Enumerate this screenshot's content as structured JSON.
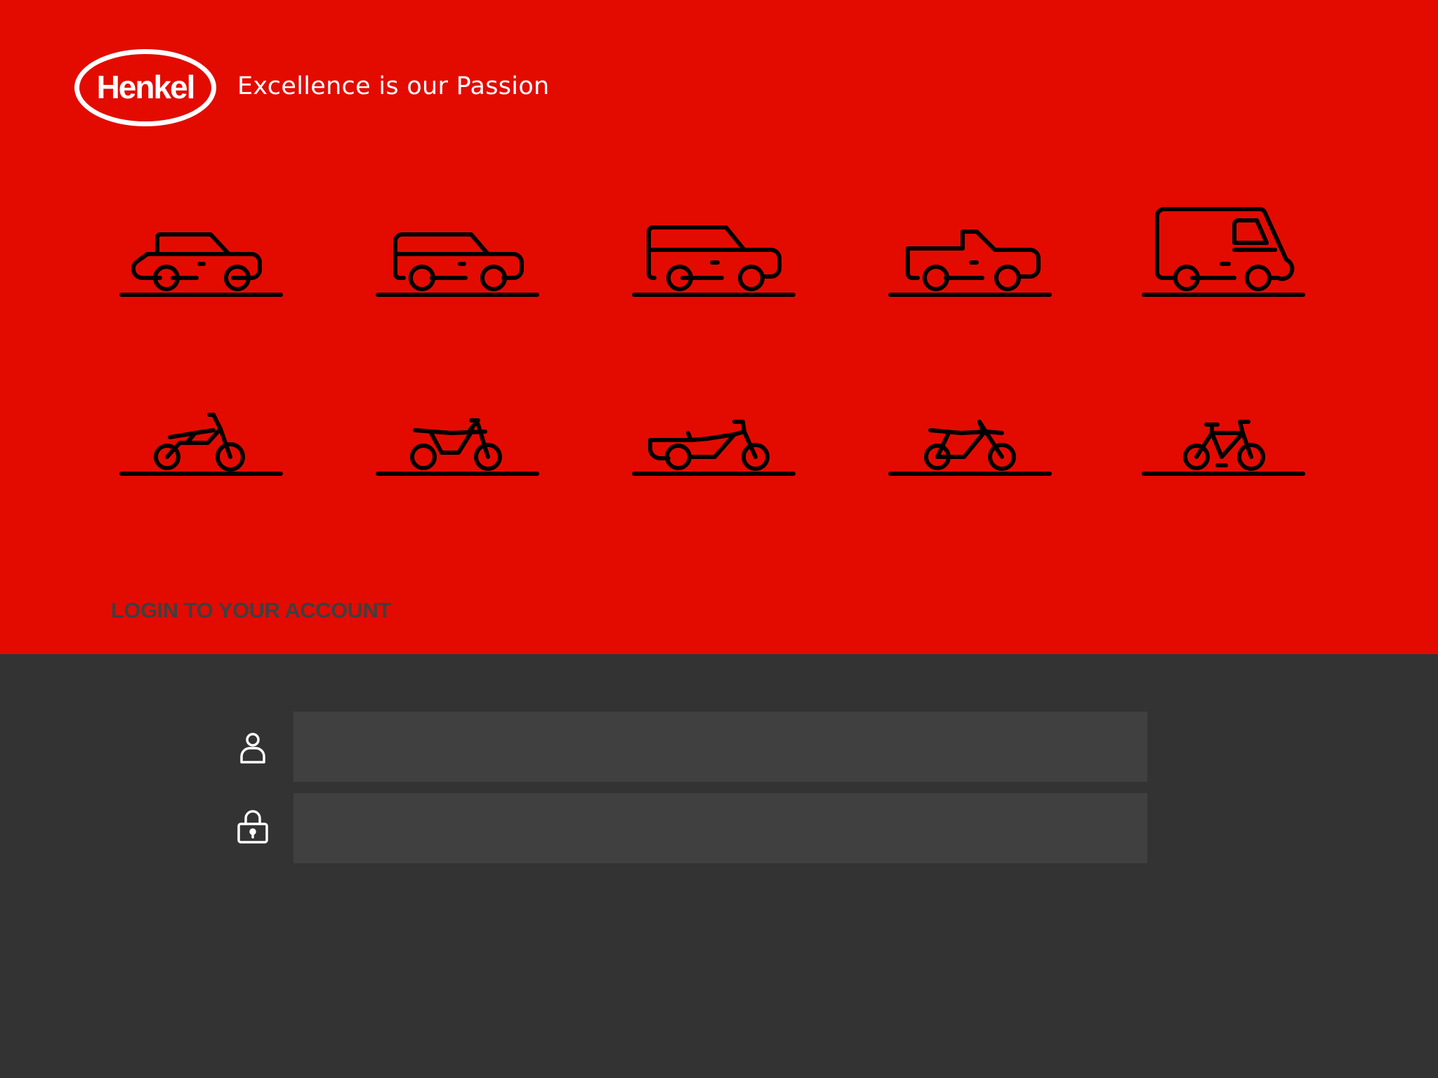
{
  "brand": {
    "logo_text": "Henkel",
    "tagline": "Excellence is our Passion",
    "colors": {
      "primary": "#e30b00",
      "dark": "#333333",
      "field": "#404040",
      "ink": "#000000"
    }
  },
  "vehicles": {
    "row1": [
      "sedan-icon",
      "suv-icon",
      "station-wagon-icon",
      "pickup-truck-icon",
      "van-icon"
    ],
    "row2": [
      "moped-icon",
      "scooter-icon",
      "motorcycle-sidecar-icon",
      "dirt-bike-icon",
      "bicycle-icon"
    ]
  },
  "login": {
    "title": "LOGIN TO YOUR ACCOUNT",
    "username": {
      "value": "",
      "placeholder": "",
      "icon": "user-icon"
    },
    "password": {
      "value": "",
      "placeholder": "",
      "icon": "lock-icon"
    }
  }
}
